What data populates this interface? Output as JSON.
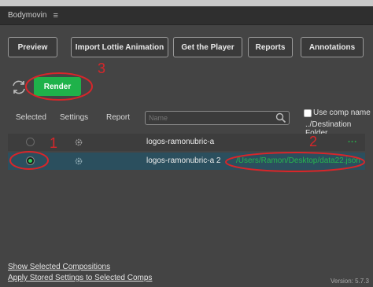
{
  "header": {
    "title": "Bodymovin",
    "menu_icon": "hamburger-icon"
  },
  "toolbar": {
    "preview": "Preview",
    "import": "Import Lottie Animation",
    "player": "Get the Player",
    "reports": "Reports",
    "annotations": "Annotations"
  },
  "render": {
    "label": "Render",
    "refresh_icon": "refresh-icon"
  },
  "list_header": {
    "selected": "Selected",
    "settings": "Settings",
    "report": "Report",
    "search_placeholder": "Name",
    "use_comp_name": "Use comp name",
    "destination_folder": "../Destination Folder"
  },
  "compositions": [
    {
      "name": "logos-ramonubric-a",
      "selected": false,
      "destination": "",
      "more": "..."
    },
    {
      "name": "logos-ramonubric-a 2",
      "selected": true,
      "destination": "/Users/Ramon/Desktop/data22.json",
      "more": ""
    }
  ],
  "annotations": [
    "1",
    "2",
    "3"
  ],
  "footer": {
    "show_selected": "Show Selected Compositions",
    "apply_settings": "Apply Stored Settings to Selected Comps",
    "version": "Version: 5.7.3"
  },
  "colors": {
    "accent_green": "#1fb24a",
    "annotation_red": "#d8262a",
    "selected_row": "#2b4f5e"
  }
}
